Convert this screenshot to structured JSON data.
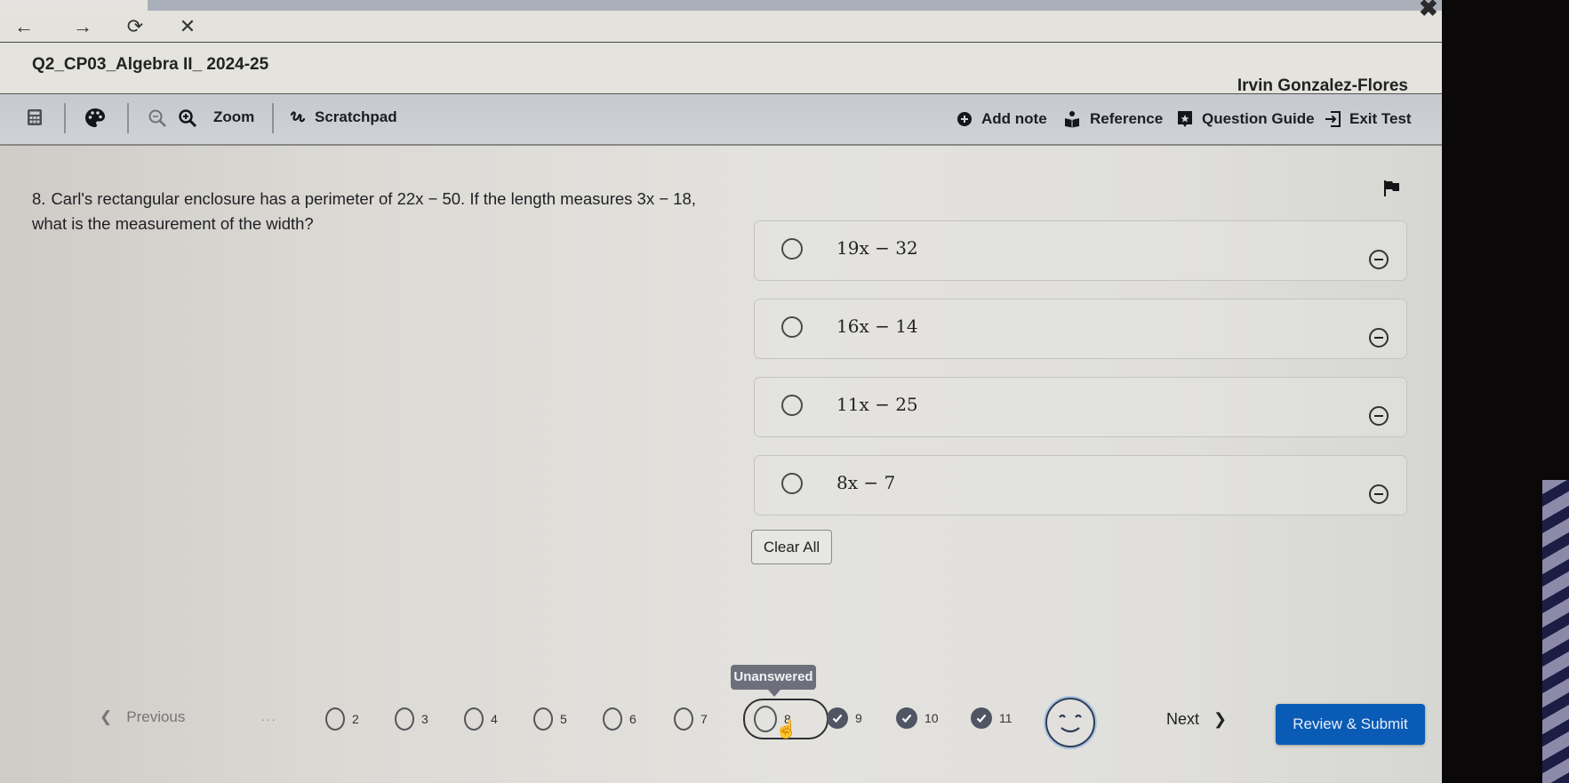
{
  "browser": {
    "back_icon": "arrow-left-icon",
    "forward_icon": "arrow-right-icon",
    "reload_icon": "reload-icon",
    "stop_icon": "close-icon",
    "window_close_icon": "close-icon"
  },
  "header": {
    "test_title": "Q2_CP03_Algebra II_ 2024-25",
    "user_name": "Irvin Gonzalez-Flores"
  },
  "toolbar": {
    "calculator_icon": "calculator-icon",
    "color_theme_icon": "palette-icon",
    "zoom_out_icon": "zoom-out-icon",
    "zoom_in_icon": "zoom-in-icon",
    "zoom_label": "Zoom",
    "scratchpad_label": "Scratchpad",
    "add_note_label": "Add note",
    "reference_label": "Reference",
    "question_guide_label": "Question Guide",
    "exit_test_label": "Exit Test"
  },
  "question": {
    "number": "8.",
    "text": "Carl's rectangular enclosure has a perimeter of 22x − 50. If the length measures 3x − 18, what is the measurement of the width?",
    "flag_icon": "flag-icon",
    "options": [
      {
        "label": "19x − 32",
        "selected": false
      },
      {
        "label": "16x − 14",
        "selected": false
      },
      {
        "label": "11x − 25",
        "selected": false
      },
      {
        "label": "8x − 7",
        "selected": false
      }
    ],
    "clear_all_label": "Clear All"
  },
  "navigation": {
    "previous_label": "Previous",
    "ellipsis": "...",
    "tooltip": "Unanswered",
    "questions": [
      {
        "number": "2",
        "status": "unanswered"
      },
      {
        "number": "3",
        "status": "unanswered"
      },
      {
        "number": "4",
        "status": "unanswered"
      },
      {
        "number": "5",
        "status": "unanswered"
      },
      {
        "number": "6",
        "status": "unanswered"
      },
      {
        "number": "7",
        "status": "unanswered"
      },
      {
        "number": "8",
        "status": "unanswered",
        "current": true
      },
      {
        "number": "9",
        "status": "answered"
      },
      {
        "number": "10",
        "status": "answered"
      },
      {
        "number": "11",
        "status": "answered"
      }
    ],
    "feedback_icon": "smiley-icon",
    "next_label": "Next",
    "review_submit_label": "Review & Submit"
  },
  "colors": {
    "primary_button": "#0a5bb5",
    "tooltip_bg": "#6d6f7b",
    "answered_check": "#4f5563"
  }
}
